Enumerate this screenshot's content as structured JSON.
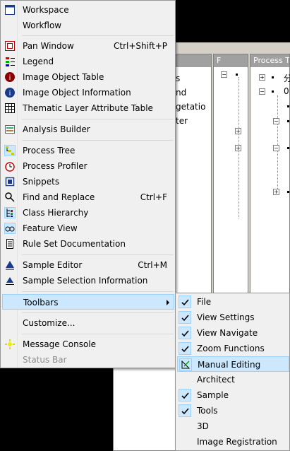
{
  "background": {
    "panel_f_title": "F",
    "panel_process_title": "Process T",
    "left_panel_texts": [
      "s",
      "nd",
      "getatio",
      "ter"
    ],
    "process_tree_texts": [
      "分",
      "0"
    ]
  },
  "menu": {
    "items": [
      {
        "label": "Workspace",
        "icon": "workspace-icon"
      },
      {
        "label": "Workflow",
        "icon": ""
      },
      {
        "label": "Pan Window",
        "shortcut": "Ctrl+Shift+P",
        "icon": "pan-window-icon"
      },
      {
        "label": "Legend",
        "icon": "legend-icon"
      },
      {
        "label": "Image Object Table",
        "icon": "image-object-table-icon"
      },
      {
        "label": "Image Object Information",
        "icon": "info-icon"
      },
      {
        "label": "Thematic Layer Attribute Table",
        "icon": "thematic-table-icon"
      },
      {
        "label": "Analysis Builder",
        "icon": "analysis-builder-icon"
      },
      {
        "label": "Process Tree",
        "icon": "process-tree-icon"
      },
      {
        "label": "Process Profiler",
        "icon": "process-profiler-icon"
      },
      {
        "label": "Snippets",
        "icon": "snippets-icon"
      },
      {
        "label": "Find and Replace",
        "shortcut": "Ctrl+F",
        "icon": "find-replace-icon"
      },
      {
        "label": "Class Hierarchy",
        "icon": "class-hierarchy-icon"
      },
      {
        "label": "Feature View",
        "icon": "feature-view-icon"
      },
      {
        "label": "Rule Set Documentation",
        "icon": "rule-set-doc-icon"
      },
      {
        "label": "Sample Editor",
        "shortcut": "Ctrl+M",
        "icon": "sample-editor-icon"
      },
      {
        "label": "Sample Selection Information",
        "icon": "sample-selection-icon"
      },
      {
        "label": "Toolbars",
        "icon": ""
      },
      {
        "label": "Customize...",
        "icon": ""
      },
      {
        "label": "Message Console",
        "icon": "message-console-icon"
      },
      {
        "label": "Status Bar",
        "icon": ""
      }
    ]
  },
  "submenu": {
    "items": [
      {
        "label": "File",
        "checked": true
      },
      {
        "label": "View Settings",
        "checked": true
      },
      {
        "label": "View Navigate",
        "checked": true
      },
      {
        "label": "Zoom Functions",
        "checked": true
      },
      {
        "label": "Manual Editing",
        "checked": false
      },
      {
        "label": "Architect",
        "checked": false
      },
      {
        "label": "Sample",
        "checked": true
      },
      {
        "label": "Tools",
        "checked": true
      },
      {
        "label": "3D",
        "checked": false
      },
      {
        "label": "Image Registration",
        "checked": false
      }
    ]
  },
  "colors": {
    "highlight": "#cce8ff",
    "highlight_border": "#99d1ff",
    "menu_bg": "#f0f0f0",
    "disabled_text": "#8d8d8d"
  }
}
